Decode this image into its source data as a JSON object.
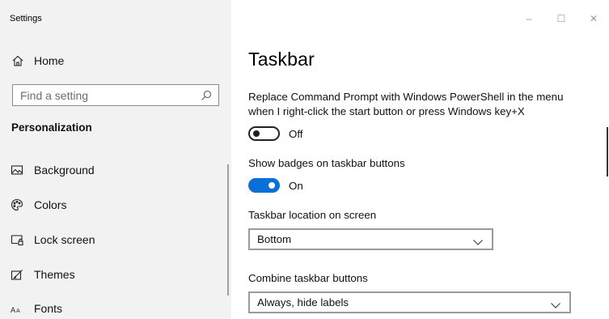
{
  "window": {
    "title": "Settings",
    "controls": {
      "minimize": "–",
      "maximize": "☐",
      "close": "✕"
    }
  },
  "sidebar": {
    "home_label": "Home",
    "search": {
      "placeholder": "Find a setting"
    },
    "section_title": "Personalization",
    "items": [
      {
        "label": "Background",
        "icon": "picture-icon"
      },
      {
        "label": "Colors",
        "icon": "palette-icon"
      },
      {
        "label": "Lock screen",
        "icon": "lock-screen-icon"
      },
      {
        "label": "Themes",
        "icon": "themes-icon"
      },
      {
        "label": "Fonts",
        "icon": "fonts-icon"
      }
    ]
  },
  "main": {
    "title": "Taskbar",
    "powershell": {
      "label": "Replace Command Prompt with Windows PowerShell in the menu when I right-click the start button or press Windows key+X",
      "state": "Off"
    },
    "badges": {
      "label": "Show badges on taskbar buttons",
      "state": "On"
    },
    "location": {
      "label": "Taskbar location on screen",
      "value": "Bottom"
    },
    "combine": {
      "label": "Combine taskbar buttons",
      "value": "Always, hide labels"
    }
  },
  "colors": {
    "accent": "#0a6fd6",
    "sidebar_bg": "#f2f2f2"
  }
}
